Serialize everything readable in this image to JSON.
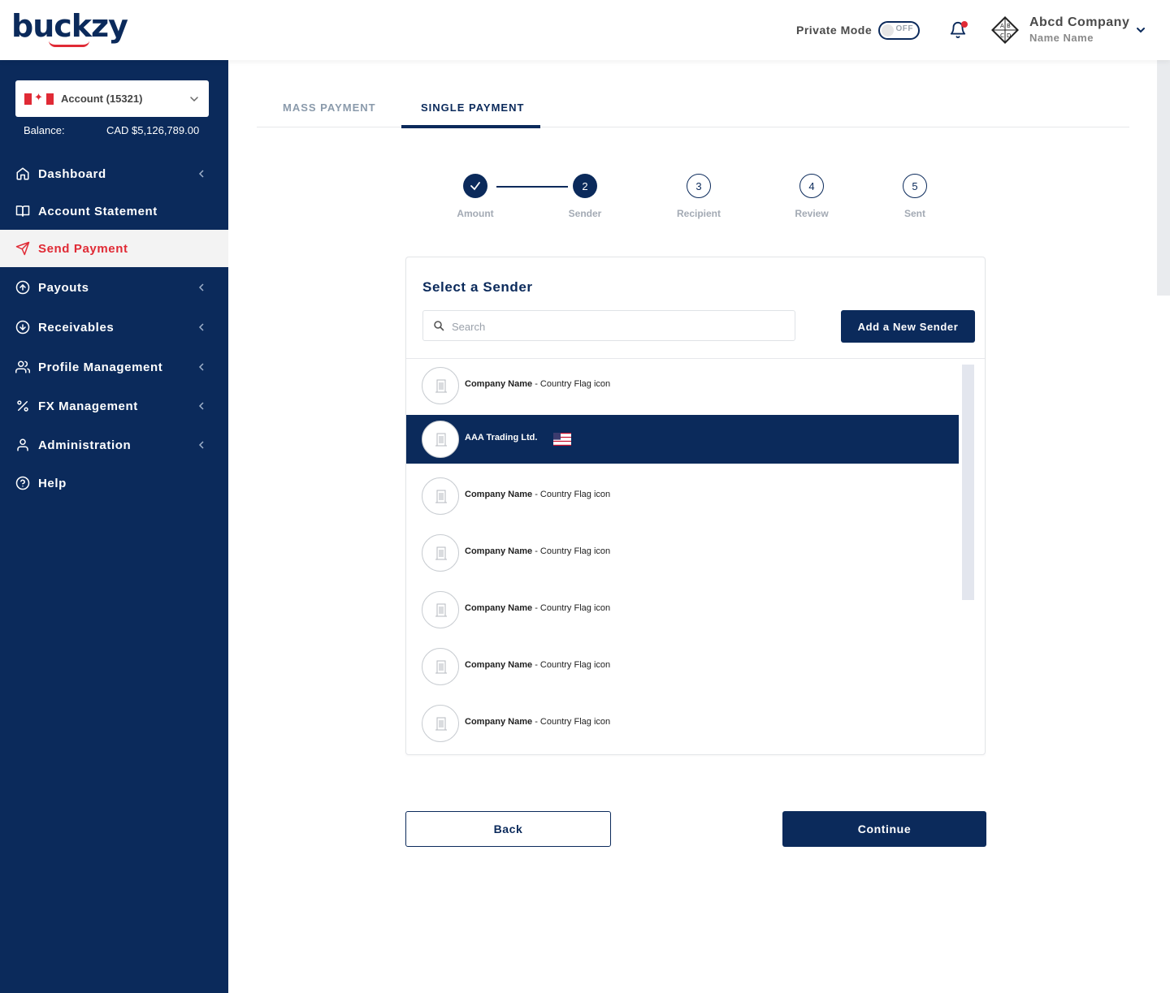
{
  "header": {
    "logo_text": "buckzy",
    "private_mode_label": "Private Mode",
    "toggle_state": "OFF",
    "company_name": "Abcd Company",
    "user_name": "Name Name",
    "icons": [
      "bell-icon",
      "company-logo",
      "chevron-down-icon"
    ],
    "notification_dot_color": "#e02a35"
  },
  "sidebar": {
    "account_select": {
      "flag": "canada-flag-icon",
      "label": "Account (15321)"
    },
    "balance_label": "Balance:",
    "balance_value": "CAD $5,126,789.00",
    "items": [
      {
        "label": "Dashboard",
        "icon": "home-icon",
        "has_chevron": true,
        "active": false
      },
      {
        "label": "Account Statement",
        "icon": "book-icon",
        "has_chevron": false,
        "active": false
      },
      {
        "label": "Send Payment",
        "icon": "send-icon",
        "has_chevron": false,
        "active": true
      },
      {
        "label": "Payouts",
        "icon": "arrow-up-circle-icon",
        "has_chevron": true,
        "active": false
      },
      {
        "label": "Receivables",
        "icon": "arrow-down-circle-icon",
        "has_chevron": true,
        "active": false
      },
      {
        "label": "Profile Management",
        "icon": "users-icon",
        "has_chevron": true,
        "active": false
      },
      {
        "label": "FX Management",
        "icon": "percent-icon",
        "has_chevron": true,
        "active": false
      },
      {
        "label": "Administration",
        "icon": "user-icon",
        "has_chevron": true,
        "active": false
      },
      {
        "label": "Help",
        "icon": "help-circle-icon",
        "has_chevron": false,
        "active": false
      }
    ]
  },
  "tabs": [
    {
      "label": "MASS PAYMENT",
      "active": false
    },
    {
      "label": "SINGLE PAYMENT",
      "active": true
    }
  ],
  "stepper": [
    {
      "number": "1",
      "label": "Amount",
      "state": "done"
    },
    {
      "number": "2",
      "label": "Sender",
      "state": "current"
    },
    {
      "number": "3",
      "label": "Recipient",
      "state": "todo"
    },
    {
      "number": "4",
      "label": "Review",
      "state": "todo"
    },
    {
      "number": "5",
      "label": "Sent",
      "state": "todo"
    }
  ],
  "sender_card": {
    "title": "Select a Sender",
    "search_placeholder": "Search",
    "add_button": "Add a New Sender",
    "senders": [
      {
        "name": "Company Name",
        "suffix": " - Country Flag icon",
        "selected": false
      },
      {
        "name": "AAA Trading Ltd.",
        "suffix": "",
        "selected": true,
        "flag": "us-flag-icon"
      },
      {
        "name": "Company Name",
        "suffix": " - Country Flag icon",
        "selected": false
      },
      {
        "name": "Company Name",
        "suffix": " - Country Flag icon",
        "selected": false
      },
      {
        "name": "Company Name",
        "suffix": " - Country Flag icon",
        "selected": false
      },
      {
        "name": "Company Name",
        "suffix": " - Country Flag icon",
        "selected": false
      },
      {
        "name": "Company Name",
        "suffix": " - Country Flag icon",
        "selected": false
      }
    ]
  },
  "buttons": {
    "back": "Back",
    "continue": "Continue"
  },
  "colors": {
    "primary": "#0b2a5b",
    "accent": "#e02a35",
    "muted": "#a3aab4"
  }
}
